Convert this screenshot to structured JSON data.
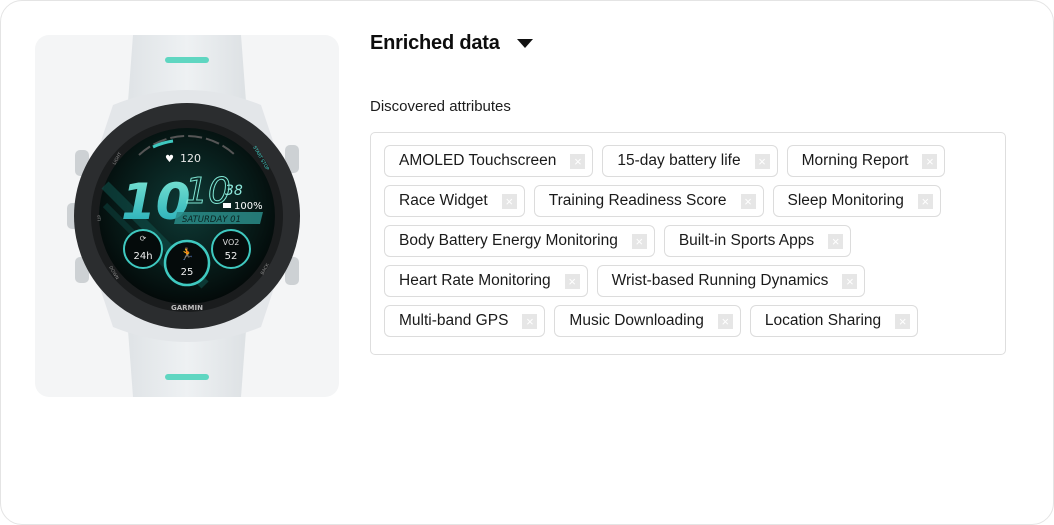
{
  "section": {
    "title": "Enriched data",
    "caret_icon": "caret-down-icon"
  },
  "attributes": {
    "label": "Discovered attributes",
    "remove_icon": "close-icon",
    "remove_glyph": "×",
    "items": [
      {
        "label": "AMOLED Touchscreen"
      },
      {
        "label": "15-day battery life"
      },
      {
        "label": "Morning Report"
      },
      {
        "label": "Race Widget"
      },
      {
        "label": "Training Readiness Score"
      },
      {
        "label": "Sleep Monitoring"
      },
      {
        "label": "Body Battery Energy Monitoring"
      },
      {
        "label": "Built-in Sports Apps"
      },
      {
        "label": "Heart Rate Monitoring"
      },
      {
        "label": "Wrist-based Running Dynamics"
      },
      {
        "label": "Multi-band GPS"
      },
      {
        "label": "Music Downloading"
      },
      {
        "label": "Location Sharing"
      }
    ]
  },
  "product_image": {
    "alt": "Garmin smartwatch, white band",
    "brand": "GARMIN",
    "face": {
      "heart_rate": "120",
      "hour": "10",
      "minute": "10",
      "seconds": "38",
      "battery": "100%",
      "date": "SATURDAY 01",
      "widget_left": "24h",
      "widget_center": "25",
      "widget_right_label": "VO2",
      "widget_right": "52",
      "bezel_labels": {
        "light": "LIGHT",
        "up": "UP",
        "down": "DOWN",
        "start_stop": "START STOP",
        "back": "BACK"
      }
    },
    "colors": {
      "accent": "#3fc9c0",
      "band": "#e7ebee",
      "bezel": "#2b2d2f"
    }
  }
}
